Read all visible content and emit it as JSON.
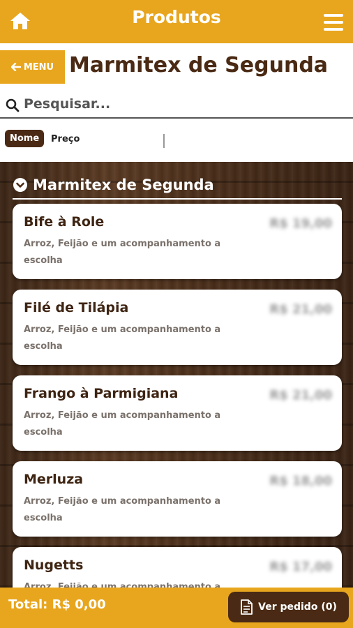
{
  "topbar": {
    "title": "Produtos",
    "home_icon": "home-icon",
    "menu_icon": "hamburger-icon"
  },
  "subheader": {
    "menu_label": "MENU",
    "page_title": "Marmitex de Segunda"
  },
  "search": {
    "placeholder": "Pesquisar...",
    "value": ""
  },
  "sort": {
    "nome_label": "Nome",
    "preco_label": "Preço",
    "active": "Nome"
  },
  "section": {
    "title": "Marmitex de Segunda"
  },
  "products": [
    {
      "name": "Bife à Role",
      "desc": "Arroz, Feijão e um acompanhamento a escolha",
      "price": "R$ 19,00"
    },
    {
      "name": "Filé de Tilápia",
      "desc": "Arroz, Feijão e um acompanhamento a escolha",
      "price": "R$ 21,00"
    },
    {
      "name": "Frango à Parmigiana",
      "desc": "Arroz, Feijão e um acompanhamento a escolha",
      "price": "R$ 21,00"
    },
    {
      "name": "Merluza",
      "desc": "Arroz, Feijão e um acompanhamento a escolha",
      "price": "R$ 18,00"
    },
    {
      "name": "Nugetts",
      "desc": "Arroz, Feijão e um acompanhamento a escolha",
      "price": "R$ 17,00"
    }
  ],
  "footer": {
    "total_label": "Total: R$ 0,00",
    "order_button": "Ver pedido (0)"
  },
  "colors": {
    "accent": "#e8a61e",
    "brown": "#4a2a14"
  }
}
